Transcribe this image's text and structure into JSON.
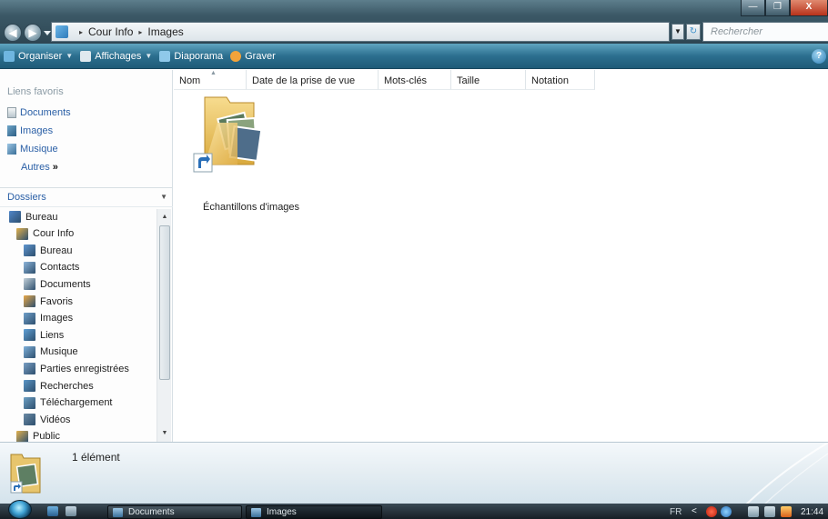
{
  "window": {
    "minimize_glyph": "—",
    "maximize_glyph": "❐",
    "close_glyph": "X"
  },
  "address": {
    "back_glyph": "◀",
    "forward_glyph": "▶",
    "breadcrumbs": [
      "Cour Info",
      "Images"
    ],
    "separator": "▸",
    "search_placeholder": "Rechercher"
  },
  "commands": [
    {
      "label": "Organiser",
      "icon": "organize-icon",
      "has_dropdown": true,
      "color": "#6fb6e0"
    },
    {
      "label": "Affichages",
      "icon": "views-icon",
      "has_dropdown": true,
      "color": "#dfe9ef"
    },
    {
      "label": "Diaporama",
      "icon": "slideshow-icon",
      "has_dropdown": false,
      "color": "#8fc9ea"
    },
    {
      "label": "Graver",
      "icon": "burn-disc-icon",
      "has_dropdown": false,
      "color": "#f2a33a"
    }
  ],
  "help_glyph": "?",
  "favorites": {
    "heading": "Liens favoris",
    "links": [
      {
        "label": "Documents",
        "icon": "documents-icon"
      },
      {
        "label": "Images",
        "icon": "pictures-icon"
      },
      {
        "label": "Musique",
        "icon": "music-icon"
      }
    ],
    "more_label": "Autres",
    "more_glyph": "»"
  },
  "folders": {
    "heading": "Dossiers",
    "tree": [
      {
        "label": "Bureau",
        "level": 0,
        "icon": "desktop-icon"
      },
      {
        "label": "Cour Info",
        "level": 1,
        "icon": "user-folder-icon"
      },
      {
        "label": "Bureau",
        "level": 2,
        "icon": "desktop-folder-icon"
      },
      {
        "label": "Contacts",
        "level": 2,
        "icon": "contacts-icon"
      },
      {
        "label": "Documents",
        "level": 2,
        "icon": "documents-icon"
      },
      {
        "label": "Favoris",
        "level": 2,
        "icon": "favorites-icon"
      },
      {
        "label": "Images",
        "level": 2,
        "icon": "pictures-icon"
      },
      {
        "label": "Liens",
        "level": 2,
        "icon": "links-icon"
      },
      {
        "label": "Musique",
        "level": 2,
        "icon": "music-icon"
      },
      {
        "label": "Parties enregistrées",
        "level": 2,
        "icon": "saved-games-icon"
      },
      {
        "label": "Recherches",
        "level": 2,
        "icon": "searches-icon"
      },
      {
        "label": "Téléchargement",
        "level": 2,
        "icon": "downloads-icon"
      },
      {
        "label": "Vidéos",
        "level": 2,
        "icon": "videos-icon"
      },
      {
        "label": "Public",
        "level": 1,
        "icon": "public-folder-icon"
      }
    ]
  },
  "columns": [
    "Nom",
    "Date de la prise de vue",
    "Mots-clés",
    "Taille",
    "Notation"
  ],
  "items": [
    {
      "name": "Échantillons d'images",
      "type": "folder-shortcut"
    }
  ],
  "details": {
    "count": "1 élément"
  },
  "taskbar": {
    "tasks": [
      {
        "label": "Documents",
        "active": false
      },
      {
        "label": "Images",
        "active": true
      }
    ],
    "language": "FR",
    "tray_chevron": "<",
    "clock": "21:44"
  }
}
